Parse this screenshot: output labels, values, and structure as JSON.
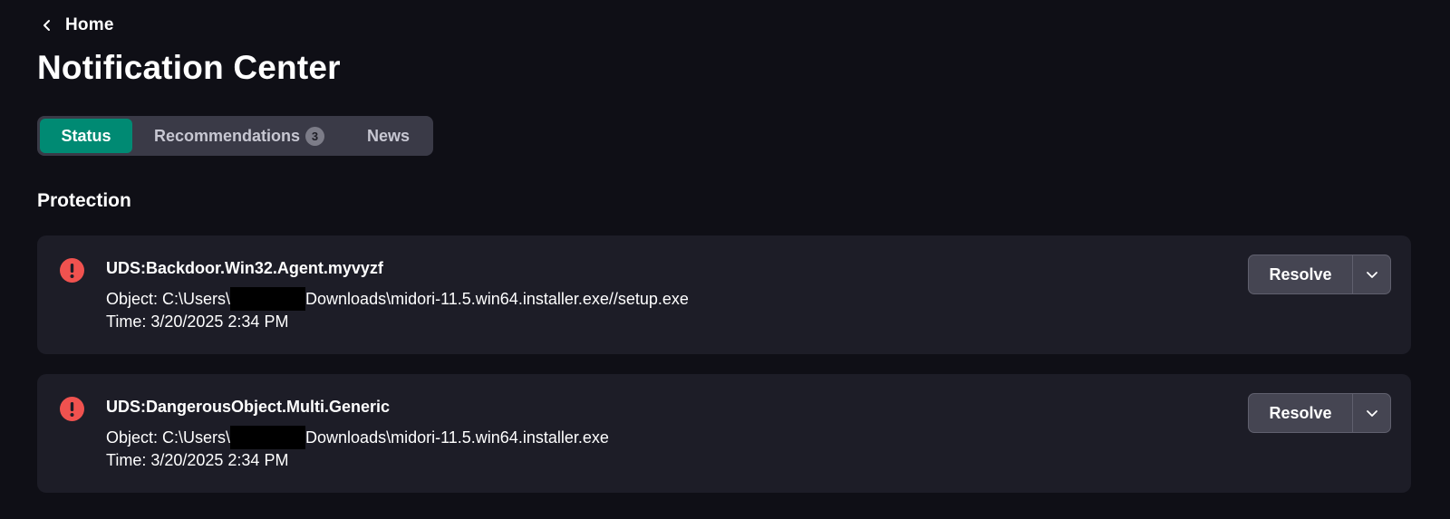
{
  "nav": {
    "back_label": "Home",
    "back_icon": "chevron-left-icon"
  },
  "page": {
    "title": "Notification Center"
  },
  "tabs": [
    {
      "label": "Status",
      "active": true
    },
    {
      "label": "Recommendations",
      "badge": "3",
      "active": false
    },
    {
      "label": "News",
      "active": false
    }
  ],
  "section": {
    "title": "Protection"
  },
  "colors": {
    "accent": "#008a73",
    "alert": "#f0524f",
    "background": "#0f0f16",
    "card": "#1d1d27"
  },
  "notifications": [
    {
      "icon": "alert-icon",
      "title": "UDS:Backdoor.Win32.Agent.myvyzf",
      "object_prefix": "Object: C:\\Users\\",
      "object_suffix": "Downloads\\midori-11.5.win64.installer.exe//setup.exe",
      "time": "Time: 3/20/2025 2:34 PM",
      "action_label": "Resolve",
      "menu_icon": "chevron-down-icon"
    },
    {
      "icon": "alert-icon",
      "title": "UDS:DangerousObject.Multi.Generic",
      "object_prefix": "Object: C:\\Users\\",
      "object_suffix": "Downloads\\midori-11.5.win64.installer.exe",
      "time": "Time: 3/20/2025 2:34 PM",
      "action_label": "Resolve",
      "menu_icon": "chevron-down-icon"
    }
  ]
}
